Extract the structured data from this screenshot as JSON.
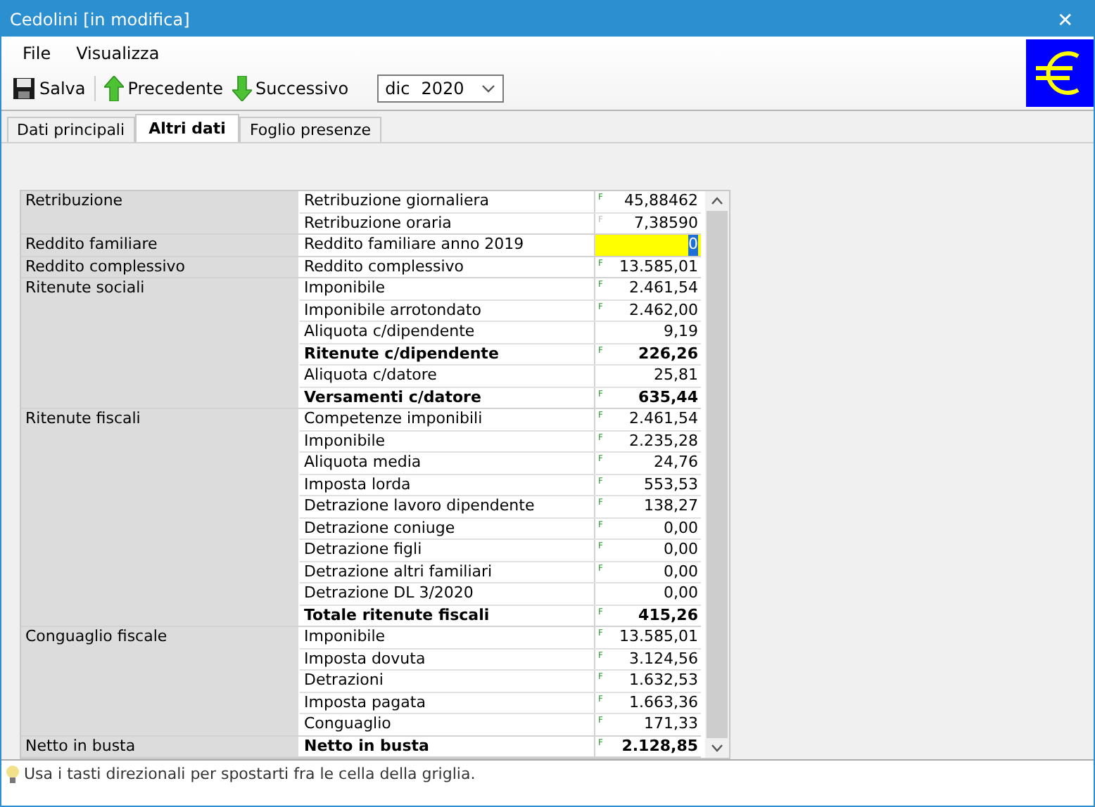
{
  "window": {
    "title": "Cedolini [in modifica]",
    "close": "✕"
  },
  "menu": [
    "File",
    "Visualizza"
  ],
  "toolbar": {
    "buttons": [
      {
        "label": "Salva",
        "kind": "save"
      },
      {
        "label": "Precedente",
        "kind": "up"
      },
      {
        "label": "Successivo",
        "kind": "down"
      }
    ],
    "period": {
      "month": "dic",
      "year": "2020"
    }
  },
  "tabs": [
    {
      "label": "Dati principali",
      "selected": false
    },
    {
      "label": "Altri dati",
      "selected": true
    },
    {
      "label": "Foglio presenze",
      "selected": false
    }
  ],
  "grid": {
    "groups": [
      {
        "label": "Retribuzione",
        "rows": [
          {
            "label": "Retribuzione giornaliera",
            "flag": "F",
            "flag_active": true,
            "value": "45,88462",
            "bold": false,
            "selected": false
          },
          {
            "label": "Retribuzione oraria",
            "flag": "F",
            "flag_active": false,
            "value": "7,38590",
            "bold": false,
            "selected": false
          }
        ]
      },
      {
        "label": "Reddito familiare",
        "rows": [
          {
            "label": "Reddito familiare anno 2019",
            "value": "0",
            "bold": false,
            "selected": true
          }
        ]
      },
      {
        "label": "Reddito complessivo",
        "rows": [
          {
            "label": "Reddito complessivo",
            "flag": "F",
            "flag_active": true,
            "value": "13.585,01",
            "bold": false,
            "selected": false
          }
        ]
      },
      {
        "label": "Ritenute sociali",
        "rows": [
          {
            "label": "Imponibile",
            "flag": "F",
            "flag_active": true,
            "value": "2.461,54",
            "bold": false,
            "selected": false
          },
          {
            "label": "Imponibile arrotondato",
            "flag": "F",
            "flag_active": true,
            "value": "2.462,00",
            "bold": false,
            "selected": false
          },
          {
            "label": "Aliquota c/dipendente",
            "value": "9,19",
            "bold": false,
            "selected": false
          },
          {
            "label": "Ritenute c/dipendente",
            "flag": "F",
            "flag_active": true,
            "value": "226,26",
            "bold": true,
            "selected": false
          },
          {
            "label": "Aliquota c/datore",
            "value": "25,81",
            "bold": false,
            "selected": false
          },
          {
            "label": "Versamenti c/datore",
            "flag": "F",
            "flag_active": true,
            "value": "635,44",
            "bold": true,
            "selected": false
          }
        ]
      },
      {
        "label": "Ritenute fiscali",
        "rows": [
          {
            "label": "Competenze imponibili",
            "flag": "F",
            "flag_active": true,
            "value": "2.461,54",
            "bold": false,
            "selected": false
          },
          {
            "label": "Imponibile",
            "flag": "F",
            "flag_active": true,
            "value": "2.235,28",
            "bold": false,
            "selected": false
          },
          {
            "label": "Aliquota media",
            "flag": "F",
            "flag_active": true,
            "value": "24,76",
            "bold": false,
            "selected": false
          },
          {
            "label": "Imposta lorda",
            "flag": "F",
            "flag_active": true,
            "value": "553,53",
            "bold": false,
            "selected": false
          },
          {
            "label": "Detrazione lavoro dipendente",
            "flag": "F",
            "flag_active": true,
            "value": "138,27",
            "bold": false,
            "selected": false
          },
          {
            "label": "Detrazione coniuge",
            "flag": "F",
            "flag_active": true,
            "value": "0,00",
            "bold": false,
            "selected": false
          },
          {
            "label": "Detrazione figli",
            "flag": "F",
            "flag_active": true,
            "value": "0,00",
            "bold": false,
            "selected": false
          },
          {
            "label": "Detrazione altri familiari",
            "flag": "F",
            "flag_active": true,
            "value": "0,00",
            "bold": false,
            "selected": false
          },
          {
            "label": "Detrazione DL 3/2020",
            "value": "0,00",
            "bold": false,
            "selected": false
          },
          {
            "label": "Totale ritenute fiscali",
            "flag": "F",
            "flag_active": true,
            "value": "415,26",
            "bold": true,
            "selected": false
          }
        ]
      },
      {
        "label": "Conguaglio fiscale",
        "rows": [
          {
            "label": "Imponibile",
            "flag": "F",
            "flag_active": true,
            "value": "13.585,01",
            "bold": false,
            "selected": false
          },
          {
            "label": "Imposta dovuta",
            "flag": "F",
            "flag_active": true,
            "value": "3.124,56",
            "bold": false,
            "selected": false
          },
          {
            "label": "Detrazioni",
            "flag": "F",
            "flag_active": true,
            "value": "1.632,53",
            "bold": false,
            "selected": false
          },
          {
            "label": "Imposta pagata",
            "flag": "F",
            "flag_active": true,
            "value": "1.663,36",
            "bold": false,
            "selected": false
          },
          {
            "label": "Conguaglio",
            "flag": "F",
            "flag_active": true,
            "value": "171,33",
            "bold": false,
            "selected": false
          }
        ]
      },
      {
        "label": "Netto in busta",
        "rows": [
          {
            "label": "Netto in busta",
            "flag": "F",
            "flag_active": true,
            "value": "2.128,85",
            "bold": true,
            "selected": false
          }
        ]
      }
    ]
  },
  "status_bar": {
    "hint": "Usa i tasti direzionali per spostarti fra le cella della griglia."
  }
}
